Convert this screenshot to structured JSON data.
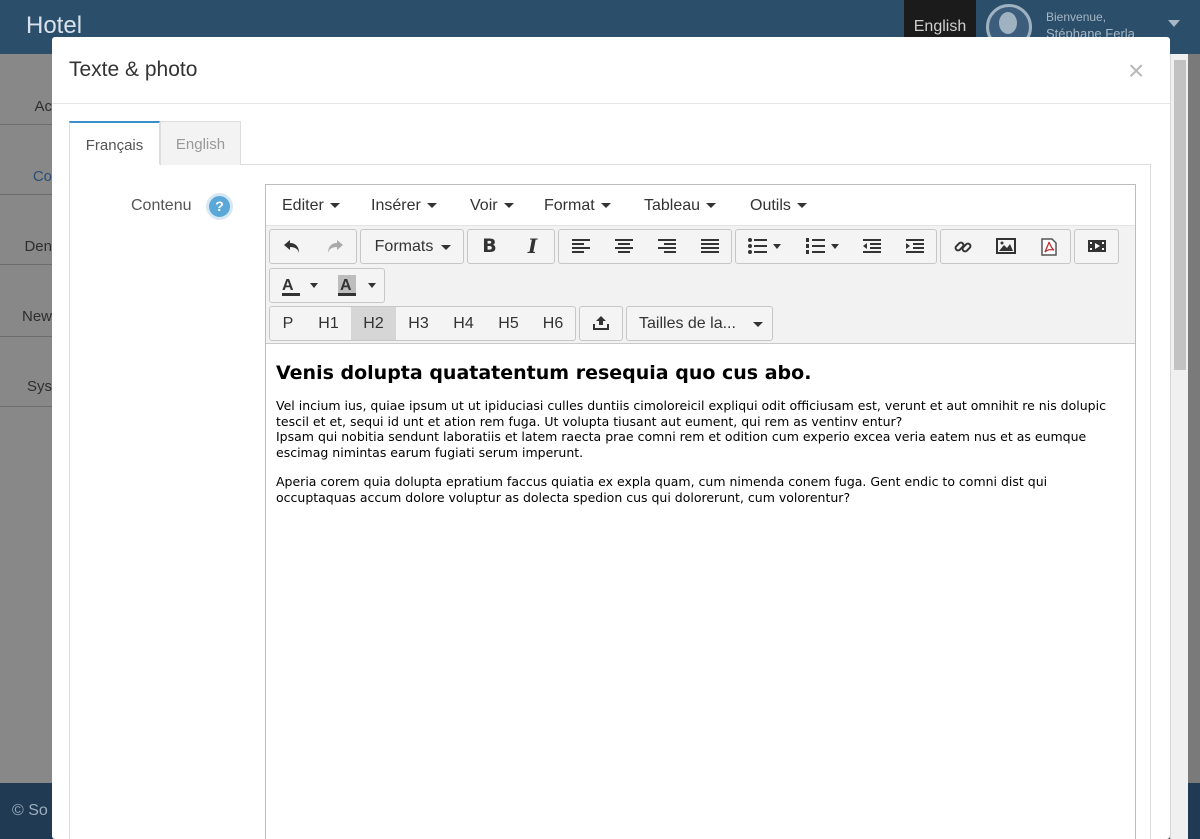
{
  "app": {
    "title": "Hotel",
    "language_tab": "English",
    "user_welcome": "Bienvenue,",
    "user_name": "Stéphane Ferla",
    "sidebar_items": [
      "Ac",
      "Co",
      "Den",
      "New",
      "Sys"
    ],
    "footer_text": "© So"
  },
  "modal": {
    "title": "Texte & photo",
    "close_label": "×",
    "tabs": [
      "Français",
      "English"
    ],
    "active_tab": "Français",
    "field_label": "Contenu",
    "help_label": "?"
  },
  "editor": {
    "menu": [
      "Editer",
      "Insérer",
      "Voir",
      "Format",
      "Tableau",
      "Outils"
    ],
    "formats_label": "Formats",
    "block_formats": [
      "P",
      "H1",
      "H2",
      "H3",
      "H4",
      "H5",
      "H6"
    ],
    "active_block_format": "H2",
    "font_size_label": "Tailles de la...",
    "text_color_label": "A",
    "bg_color_label": "A",
    "icons": [
      "undo-icon",
      "redo-icon",
      "bold-icon",
      "italic-icon",
      "align-left-icon",
      "align-center-icon",
      "align-right-icon",
      "align-justify-icon",
      "bullet-list-icon",
      "numbered-list-icon",
      "outdent-icon",
      "indent-icon",
      "link-icon",
      "image-icon",
      "pdf-icon",
      "media-icon",
      "upload-icon"
    ],
    "content": {
      "heading": "Venis dolupta quatatentum resequia quo cus abo.",
      "paragraph1_line1": "Vel incium ius, quiae ipsum ut ut ipiduciasi culles duntiis cimoloreicil expliqui odit officiusam est, verunt et aut omnihit re nis dolupic tescil et et, sequi id unt et ation rem fuga. Ut volupta tiusant aut eument, qui rem as ventinv entur?",
      "paragraph1_line2": "Ipsam qui nobitia sendunt laboratiis et latem raecta prae comni rem et odition cum experio excea veria eatem nus et as eumque escimag nimintas earum fugiati serum imperunt.",
      "paragraph2": "Aperia corem quia dolupta epratium faccus quiatia ex expla quam, cum nimenda conem fuga. Gent endic to comni dist qui occuptaquas accum dolore voluptur as dolecta spedion cus qui dolorerunt, cum volorentur?"
    }
  },
  "colors": {
    "header_bg": "#2b4e6b",
    "active_tab_accent": "#3b8ec8",
    "help_icon": "#5aa8d8"
  }
}
